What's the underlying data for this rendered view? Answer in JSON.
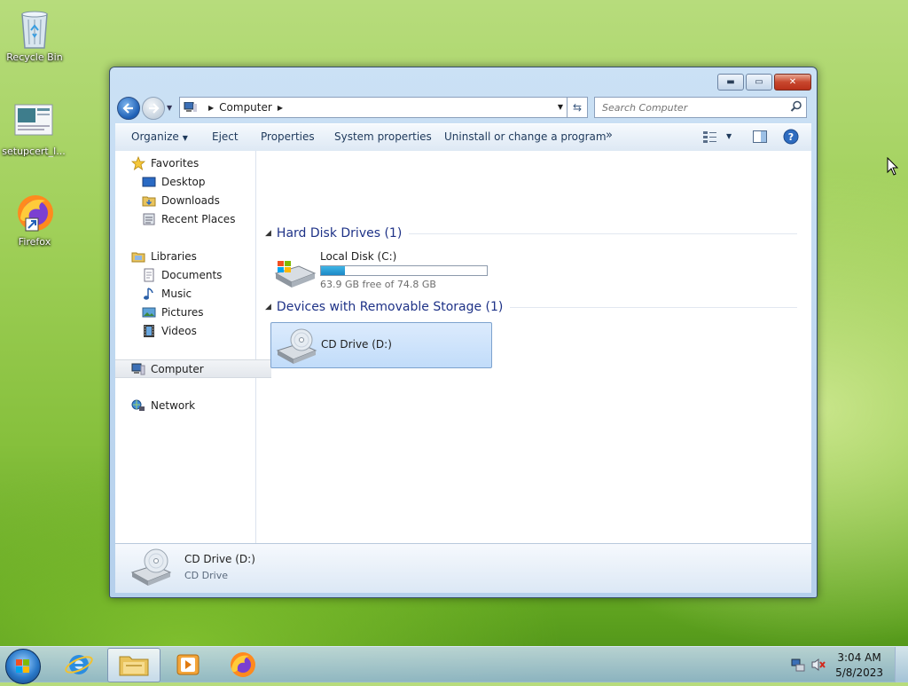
{
  "desktop": {
    "icons": [
      {
        "label": "Recycle Bin"
      },
      {
        "label": "setupcert_l..."
      },
      {
        "label": "Firefox"
      }
    ]
  },
  "window": {
    "caption": {
      "minimize": "▬",
      "maximize": "▭",
      "close": "✕"
    },
    "address": {
      "segments": [
        "Computer"
      ]
    },
    "search": {
      "placeholder": "Search Computer"
    },
    "toolbar": {
      "organize": "Organize",
      "eject": "Eject",
      "properties": "Properties",
      "system_properties": "System properties",
      "uninstall": "Uninstall or change a program",
      "more": "»"
    },
    "nav": {
      "favorites": "Favorites",
      "desktop": "Desktop",
      "downloads": "Downloads",
      "recent_places": "Recent Places",
      "libraries": "Libraries",
      "documents": "Documents",
      "music": "Music",
      "pictures": "Pictures",
      "videos": "Videos",
      "computer": "Computer",
      "network": "Network"
    },
    "groups": {
      "hdd": {
        "title": "Hard Disk Drives (1)",
        "drive_name": "Local Disk (C:)",
        "free_text": "63.9 GB free of 74.8 GB",
        "used_fraction": 0.146
      },
      "removable": {
        "title": "Devices with Removable Storage (1)",
        "drive_name": "CD Drive (D:)"
      }
    },
    "details": {
      "name": "CD Drive (D:)",
      "type": "CD Drive"
    }
  },
  "taskbar": {
    "clock": {
      "time": "3:04 AM",
      "date": "5/8/2023"
    }
  },
  "colors": {
    "group_header": "#1e3287",
    "selection": "#c1dcfa",
    "bar_fill": "#1c88c6"
  }
}
